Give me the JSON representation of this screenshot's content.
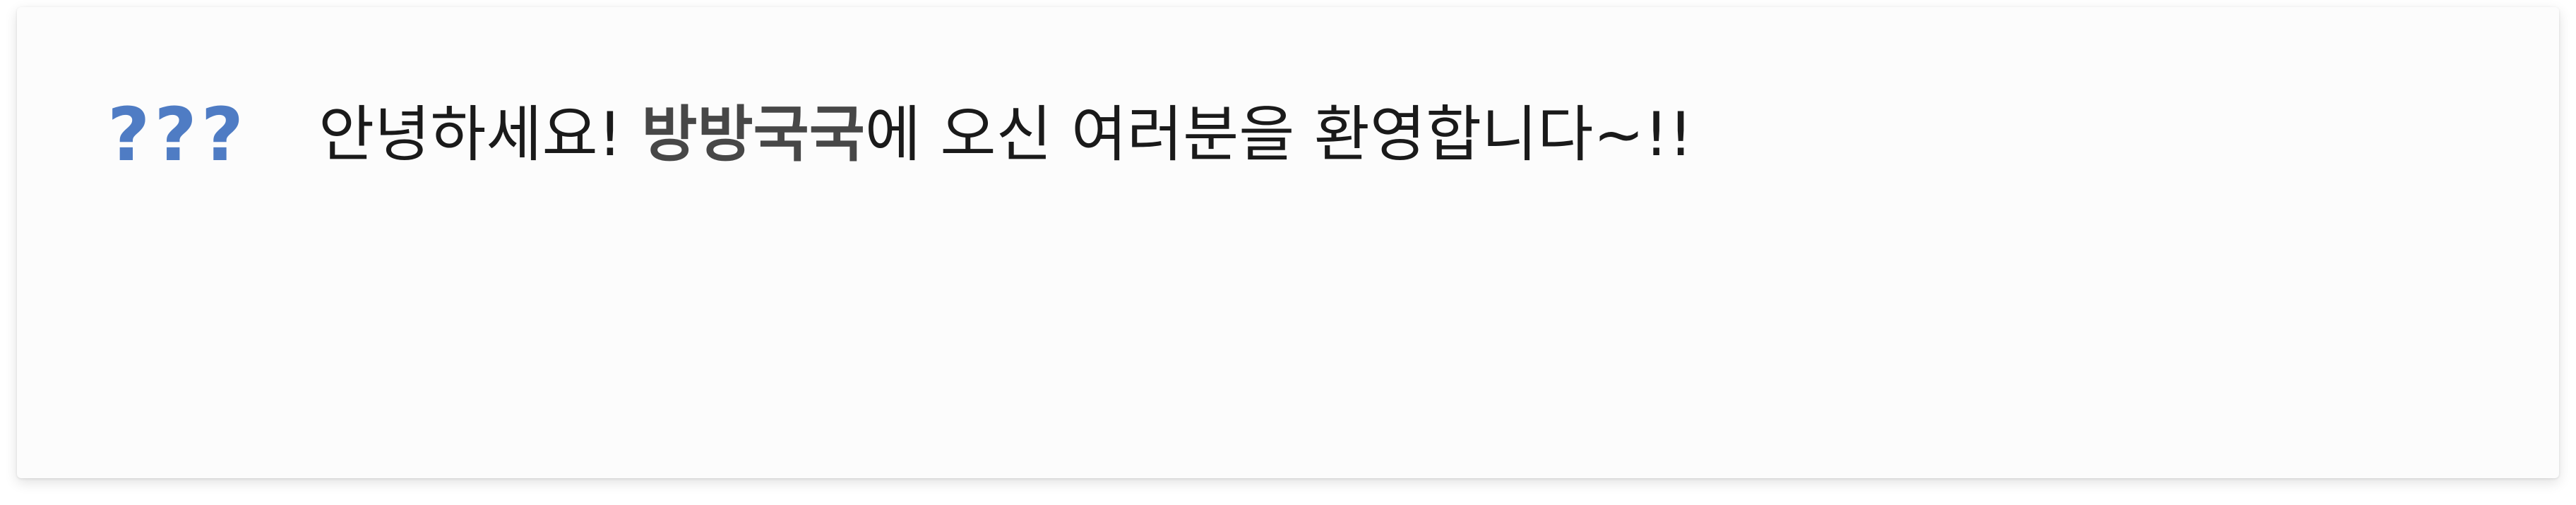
{
  "notice": {
    "icon": {
      "glyph": "???",
      "semantic": "unrendered-emoji-placeholder-icon",
      "color": "#4f7cc4"
    },
    "greeting_before": "안녕하세요! ",
    "brand": "방방국국",
    "greeting_after": "에 오신 여러분을 환영합니다~!!",
    "colors": {
      "text": "#1a1a1a",
      "brand": "#474747",
      "card_background": "#fcfcfc"
    }
  }
}
